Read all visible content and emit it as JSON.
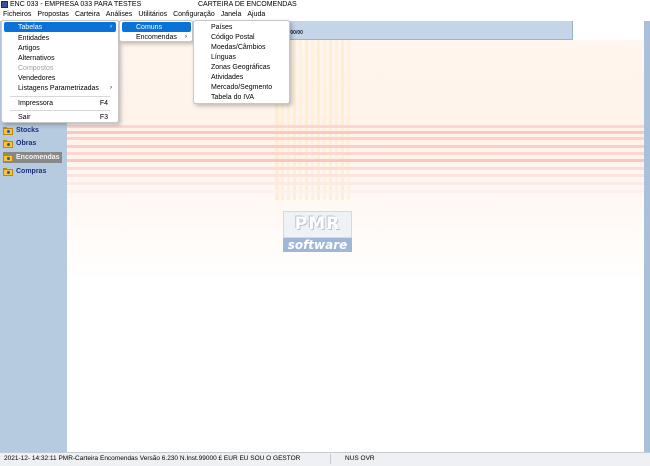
{
  "window": {
    "title": "ENC 033 - EMPRESA 033 PARA TESTES",
    "doc_title": "CARTEIRA DE ENCOMENDAS"
  },
  "menubar": [
    "Ficheiros",
    "Propostas",
    "Carteira",
    "Análises",
    "Utilitários",
    "Configuração",
    "Janela",
    "Ajuda"
  ],
  "ficheiros_menu": {
    "tabelas": "Tabelas",
    "entidades": "Entidades",
    "artigos": "Artigos",
    "alternativos": "Alternativos",
    "compostos": "Compostos",
    "vendedores": "Vendedores",
    "listagens": "Listagens Parametrizadas",
    "impressora": "Impressora",
    "impressora_shortcut": "F4",
    "sair": "Sair",
    "sair_shortcut": "F3"
  },
  "tabelas_menu": {
    "comuns": "Comuns",
    "encomendas": "Encomendas"
  },
  "comuns_menu": [
    "Países",
    "Código Postal",
    "Moedas/Câmbios",
    "Línguas",
    "Zonas Geográficas",
    "Atividades",
    "Mercado/Segmento",
    "Tabela do IVA"
  ],
  "mdi": {
    "date_fragment": "/00/00"
  },
  "sidebar": {
    "items": [
      "Stocks",
      "Obras",
      "Encomendas",
      "Compras"
    ],
    "active": "Encomendas"
  },
  "logo": {
    "top": "PMR",
    "bottom": "software"
  },
  "status": {
    "left": "2021-12-  14:32:11  PMR-Carteira Encomendas    Versão  6.230    N.Inst.99000    £ EUR     EU SOU O GESTOR",
    "right": "NUS  OVR"
  },
  "colors": {
    "menu_highlight": "#0b73d8",
    "sidebar_bg": "#b7cbe0",
    "sidebar_active": "#888888",
    "stripe_pink": "#f9c4c0"
  }
}
